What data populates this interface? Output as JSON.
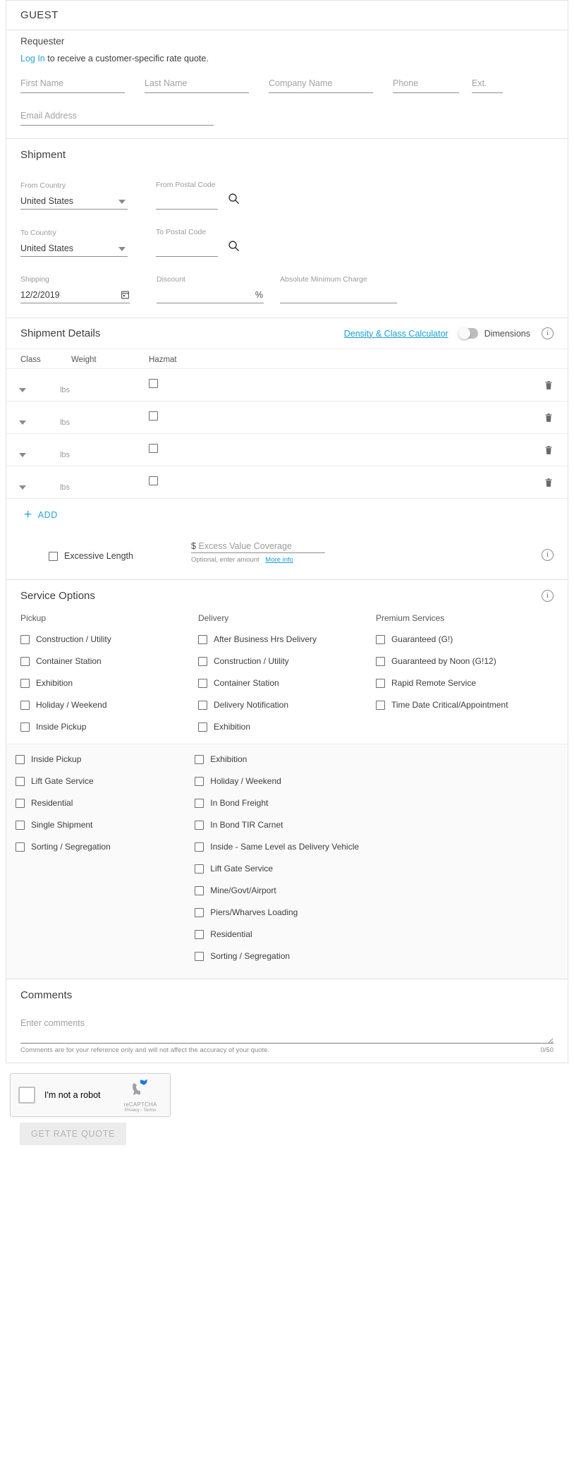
{
  "header": {
    "title": "GUEST"
  },
  "requester": {
    "title": "Requester",
    "login_link": "Log In",
    "login_text": " to receive a customer-specific rate quote.",
    "fields": [
      {
        "placeholder": "First Name",
        "value": ""
      },
      {
        "placeholder": "Last Name",
        "value": ""
      },
      {
        "placeholder": "Company Name",
        "value": ""
      },
      {
        "placeholder": "Phone",
        "value": ""
      },
      {
        "placeholder": "Ext.",
        "value": ""
      },
      {
        "placeholder": "Email Address",
        "value": ""
      }
    ]
  },
  "shipment": {
    "title": "Shipment",
    "from_country_label": "From Country",
    "from_country_value": "United States",
    "from_postal_label": "From Postal Code",
    "from_postal_value": "",
    "to_country_label": "To Country",
    "to_country_value": "United States",
    "to_postal_label": "To Postal Code",
    "to_postal_value": "",
    "shipping_label": "Shipping",
    "shipping_value": "12/2/2019",
    "discount_label": "Discount",
    "discount_value": "",
    "discount_suffix": "%",
    "abs_min_label": "Absolute Minimum Charge",
    "abs_min_value": ""
  },
  "shipment_details": {
    "title": "Shipment Details",
    "calculator_link": "Density & Class Calculator",
    "dimensions_label": "Dimensions",
    "columns": [
      "Class",
      "Weight",
      "Hazmat"
    ],
    "weight_unit": "lbs",
    "rows": [
      {
        "class": "",
        "weight": "",
        "hazmat": false
      },
      {
        "class": "",
        "weight": "",
        "hazmat": false
      },
      {
        "class": "",
        "weight": "",
        "hazmat": false
      },
      {
        "class": "",
        "weight": "",
        "hazmat": false
      }
    ],
    "add_label": "ADD",
    "excessive_length_label": "Excessive Length",
    "evc_currency": "$",
    "evc_placeholder": "Excess Value Coverage",
    "evc_hint": "Optional, enter amount",
    "evc_more_info": "More info"
  },
  "service_options": {
    "title": "Service Options",
    "block1": {
      "columns": [
        {
          "heading": "Pickup",
          "items": [
            "Construction / Utility",
            "Container Station",
            "Exhibition",
            "Holiday / Weekend",
            "Inside Pickup"
          ]
        },
        {
          "heading": "Delivery",
          "items": [
            "After Business Hrs Delivery",
            "Construction / Utility",
            "Container Station",
            "Delivery Notification",
            "Exhibition"
          ]
        },
        {
          "heading": "Premium Services",
          "items": [
            "Guaranteed (G!)",
            "Guaranteed by Noon (G!12)",
            "Rapid Remote Service",
            "Time Date Critical/Appointment"
          ]
        }
      ]
    },
    "block2": {
      "columns": [
        {
          "heading": "",
          "items": [
            "Inside Pickup",
            "Lift Gate Service",
            "Residential",
            "Single Shipment",
            "Sorting / Segregation"
          ]
        },
        {
          "heading": "",
          "items": [
            "Exhibition",
            "Holiday / Weekend",
            "In Bond Freight",
            "In Bond TIR Carnet",
            "Inside - Same Level as Delivery Vehicle",
            "Lift Gate Service",
            "Mine/Govt/Airport",
            "Piers/Wharves Loading",
            "Residential",
            "Sorting / Segregation"
          ]
        },
        {
          "heading": "",
          "items": []
        }
      ]
    }
  },
  "comments": {
    "title": "Comments",
    "placeholder": "Enter comments",
    "hint": "Comments are for your reference only and will not affect the accuracy of your quote.",
    "counter": "0/50"
  },
  "captcha": {
    "label": "I'm not a robot",
    "brand": "reCAPTCHA",
    "privacy_terms": "Privacy - Terms"
  },
  "submit": {
    "label": "GET RATE QUOTE"
  },
  "colors": {
    "link": "#29a3d4",
    "accent": "#1a9ed4",
    "text": "#3d3d3d"
  }
}
